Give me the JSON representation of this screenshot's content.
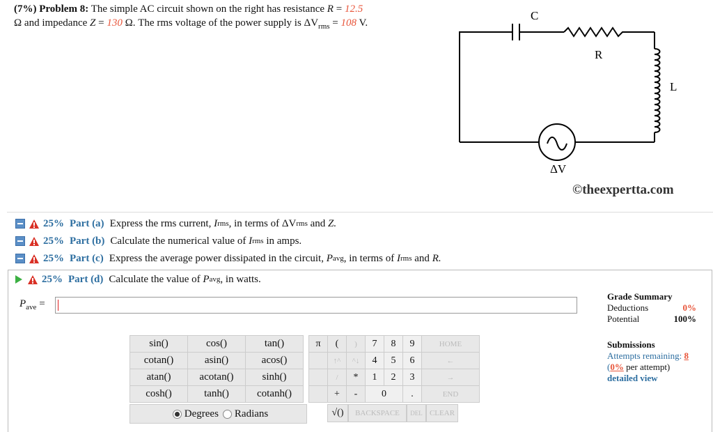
{
  "problem": {
    "prefix": "(7%) Problem 8:",
    "text1": "The simple AC circuit shown on the right has resistance",
    "R_label": "R",
    "eq": "=",
    "R_val": "12.5",
    "omega": "Ω",
    "text2": "and impedance",
    "Z_label": "Z",
    "Z_val": "130",
    "text3": "The rms voltage of the power supply is",
    "dV": "ΔV",
    "rms": "rms",
    "V_val": "108",
    "V_unit": "V."
  },
  "circuit": {
    "C": "C",
    "R": "R",
    "L": "L",
    "dV": "ΔV"
  },
  "copyright": "©theexpertta.com",
  "parts": [
    {
      "pct": "25%",
      "name": "Part (a)",
      "text": "Express the rms current,",
      "t2": "in terms of",
      "t3": "and",
      "t4": "Z."
    },
    {
      "pct": "25%",
      "name": "Part (b)",
      "text": "Calculate the numerical value of",
      "t2": "in amps."
    },
    {
      "pct": "25%",
      "name": "Part (c)",
      "text": "Express the average power dissipated in the circuit,",
      "t2": "in terms of",
      "t3": "and",
      "t4": "R."
    },
    {
      "pct": "25%",
      "name": "Part (d)",
      "text": "Calculate the value of",
      "t2": "in watts."
    }
  ],
  "vars": {
    "I": "I",
    "rms": "rms",
    "P": "P",
    "avg": "avg",
    "ave": "ave",
    "comma": ",",
    "eq": "="
  },
  "grade": {
    "title": "Grade Summary",
    "deductions_label": "Deductions",
    "deductions": "0%",
    "potential_label": "Potential",
    "potential": "100%"
  },
  "submissions": {
    "title": "Submissions",
    "attempts_label": "Attempts remaining:",
    "attempts": "8",
    "per_open": "(",
    "per_pct": "0%",
    "per_text": "per attempt)",
    "detailed": "detailed view"
  },
  "funcs": [
    [
      "sin()",
      "cos()",
      "tan()"
    ],
    [
      "cotan()",
      "asin()",
      "acos()"
    ],
    [
      "atan()",
      "acotan()",
      "sinh()"
    ],
    [
      "cosh()",
      "tanh()",
      "cotanh()"
    ]
  ],
  "keypad": [
    [
      "π",
      "(",
      ")",
      "7",
      "8",
      "9",
      "HOME"
    ],
    [
      "",
      "↑^",
      "^↓",
      "4",
      "5",
      "6",
      "←"
    ],
    [
      "",
      "/",
      "*",
      "1",
      "2",
      "3",
      "→"
    ],
    [
      "",
      "+",
      "-",
      "0",
      "",
      ".",
      "END"
    ]
  ],
  "angle": {
    "degrees": "Degrees",
    "radians": "Radians",
    "selected": "Degrees"
  },
  "bottomkeys": {
    "sqrt": "√()",
    "backspace": "BACKSPACE",
    "del": "DEL",
    "clear": "CLEAR"
  }
}
